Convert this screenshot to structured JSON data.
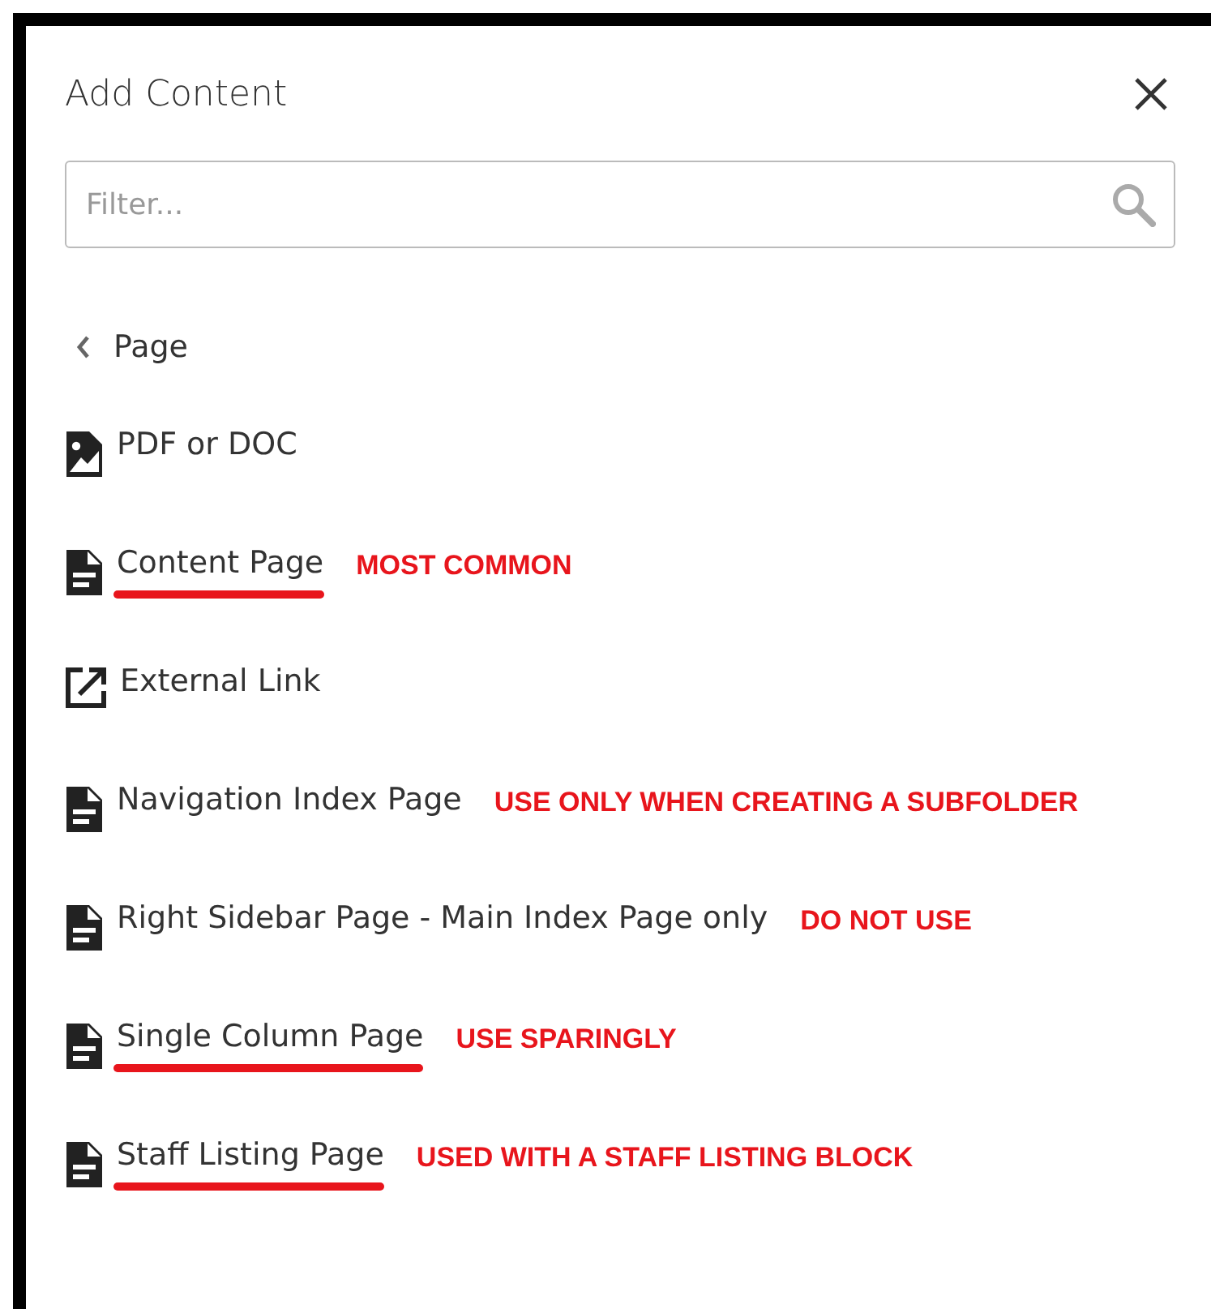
{
  "panel": {
    "title": "Add Content"
  },
  "filter": {
    "placeholder": "Filter..."
  },
  "back": {
    "label": "Page"
  },
  "items": [
    {
      "kind": "pdf",
      "label": "PDF or DOC",
      "underlined": false
    },
    {
      "kind": "page",
      "label": "Content Page",
      "underlined": true,
      "note": "MOST COMMON"
    },
    {
      "kind": "link",
      "label": "External Link",
      "underlined": false
    },
    {
      "kind": "page",
      "label": "Navigation Index Page",
      "underlined": false,
      "note": "USE ONLY WHEN CREATING A SUBFOLDER"
    },
    {
      "kind": "page",
      "label": "Right Sidebar Page - Main Index Page only",
      "underlined": false,
      "note": "DO NOT USE"
    },
    {
      "kind": "page",
      "label": "Single Column Page",
      "underlined": true,
      "note": "USE SPARINGLY"
    },
    {
      "kind": "page",
      "label": "Staff Listing Page",
      "underlined": true,
      "note": "USED WITH A STAFF LISTING BLOCK"
    }
  ]
}
